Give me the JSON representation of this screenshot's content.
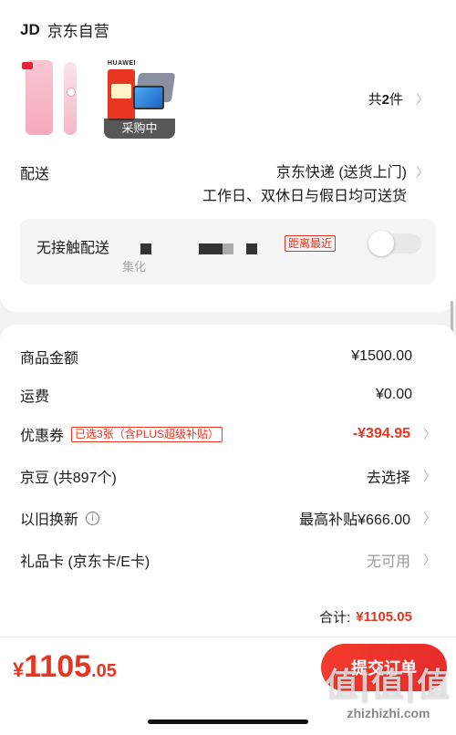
{
  "shop": {
    "logo": "JD",
    "name": "京东自营"
  },
  "products": {
    "items": [
      {
        "name": "toothbrush"
      },
      {
        "brand_text": "HUAWEI",
        "status": "采购中"
      }
    ],
    "count_prefix": "共",
    "count": "2",
    "count_suffix": "件"
  },
  "delivery": {
    "label": "配送",
    "method": "京东快递 (送货上门)",
    "schedule": "工作日、双休日与假日均可送货"
  },
  "no_contact": {
    "label": "无接触配送",
    "faint": "集化",
    "tag": "距离最近",
    "enabled": false
  },
  "summary": {
    "items": [
      {
        "label": "商品金额",
        "value": "¥1500.00"
      },
      {
        "label": "运费",
        "value": "¥0.00"
      },
      {
        "label": "优惠券",
        "tag": "已选3张（含PLUS超级补贴）",
        "value": "-¥394.95"
      },
      {
        "label": "京豆 (共897个)",
        "value": "去选择"
      },
      {
        "label": "以旧换新",
        "info_icon": "info-icon",
        "value": "最高补贴¥666.00"
      },
      {
        "label": "礼品卡 (京东卡/E卡)",
        "value": "无可用"
      }
    ],
    "total_label": "合计:",
    "total_value": "¥1105.05"
  },
  "footer": {
    "currency": "¥",
    "price_int": "1105",
    "price_dec": ".05",
    "submit_label": "提交订单"
  },
  "watermark": {
    "logo": "值|值|值",
    "url": "zhizhizhi.com"
  },
  "colors": {
    "accent": "#e7351f",
    "background": "#f2f2f2"
  }
}
